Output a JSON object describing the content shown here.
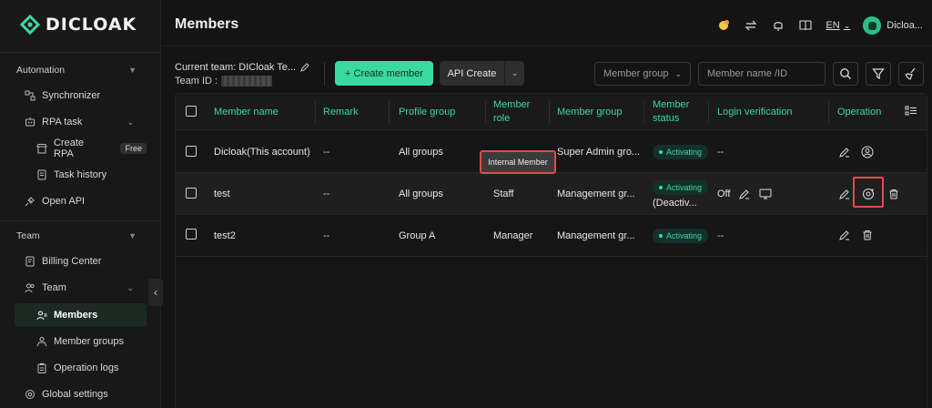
{
  "app": {
    "logo_text": "DICLOAK"
  },
  "sidebar": {
    "sections": [
      {
        "label": "Automation"
      },
      {
        "label": "Team"
      }
    ],
    "items": [
      {
        "label": "Synchronizer"
      },
      {
        "label": "RPA task"
      },
      {
        "label": "Create RPA",
        "badge": "Free"
      },
      {
        "label": "Task history"
      },
      {
        "label": "Open API"
      },
      {
        "label": "Billing Center"
      },
      {
        "label": "Team"
      },
      {
        "label": "Members"
      },
      {
        "label": "Member groups"
      },
      {
        "label": "Operation logs"
      },
      {
        "label": "Global settings"
      }
    ]
  },
  "header": {
    "title": "Members",
    "language": "EN",
    "user_name": "Dicloa..."
  },
  "toolbar": {
    "current_team_label": "Current team: DICloak Te...",
    "team_id_label": "Team ID :",
    "create_member_label": "+ Create member",
    "api_create_label": "API Create",
    "member_group_placeholder": "Member group",
    "search_placeholder": "Member name /ID"
  },
  "table": {
    "columns": {
      "name": "Member name",
      "remark": "Remark",
      "profile_group": "Profile group",
      "role_line1": "Member",
      "role_line2": "role",
      "member_group": "Member group",
      "status_line1": "Member",
      "status_line2": "status",
      "login": "Login verification",
      "operation": "Operation"
    },
    "rows": [
      {
        "name": "Dicloak(This account)",
        "remark": "--",
        "profile_group": "All groups",
        "role": "",
        "member_group": "Super Admin gro...",
        "status": "Activating",
        "login": "--"
      },
      {
        "name": "test",
        "remark": "--",
        "profile_group": "All groups",
        "role": "Staff",
        "member_group": "Management gr...",
        "status": "Activating",
        "status_extra": "(Deactiv...",
        "login": "Off"
      },
      {
        "name": "test2",
        "remark": "--",
        "profile_group": "Group A",
        "role": "Manager",
        "member_group": "Management gr...",
        "status": "Activating",
        "login": "--"
      }
    ],
    "tooltip": "Internal Member"
  },
  "colors": {
    "accent": "#3ad9a1",
    "highlight": "#e14a4a",
    "background": "#141414"
  }
}
